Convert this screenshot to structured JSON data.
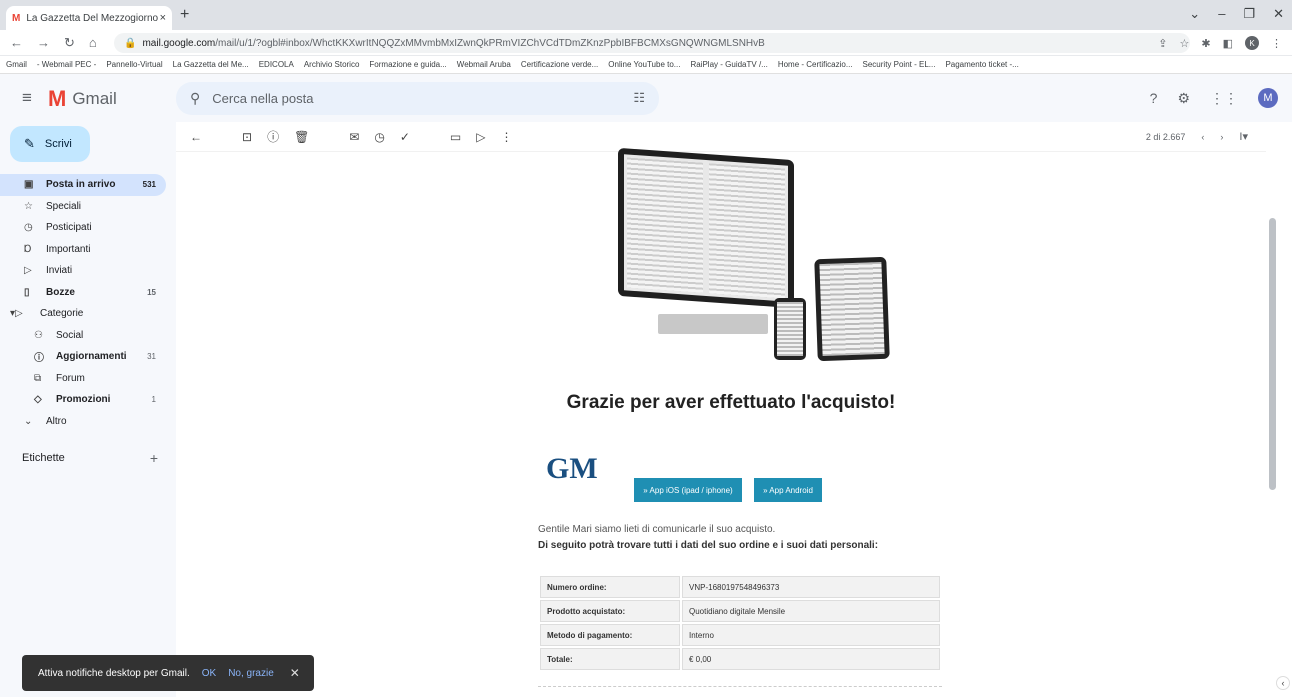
{
  "browser": {
    "tab_title": "La Gazzetta Del Mezzogiorno - A",
    "tab_close": "×",
    "new_tab": "+",
    "url_domain": "mail.google.com",
    "url_path": "/mail/u/1/?ogbl#inbox/WhctKKXwrItNQQZxMMvmbMxIZwnQkPRmVIZChVCdTDmZKnzPpbIBFBCMXsGNQWNGMLSNHvB",
    "profile": "K"
  },
  "bookmarks": [
    "Gmail",
    "- Webmail PEC -",
    "Pannello-Virtual",
    "La Gazzetta del Me...",
    "EDICOLA",
    "Archivio Storico",
    "Formazione e guida...",
    "Webmail Aruba",
    "Certificazione verde...",
    "Online YouTube to...",
    "RaiPlay - GuidaTV /...",
    "Home - Certificazio...",
    "Security Point - EL...",
    "Pagamento ticket -..."
  ],
  "gmail": {
    "brand": "Gmail",
    "search_placeholder": "Cerca nella posta",
    "avatar": "M",
    "compose": "Scrivi"
  },
  "sidebar": {
    "items": [
      {
        "label": "Posta in arrivo",
        "count": "531"
      },
      {
        "label": "Speciali",
        "count": ""
      },
      {
        "label": "Posticipati",
        "count": ""
      },
      {
        "label": "Importanti",
        "count": ""
      },
      {
        "label": "Inviati",
        "count": ""
      },
      {
        "label": "Bozze",
        "count": "15"
      },
      {
        "label": "Categorie",
        "count": ""
      },
      {
        "label": "Social",
        "count": ""
      },
      {
        "label": "Aggiornamenti",
        "count": "31"
      },
      {
        "label": "Forum",
        "count": ""
      },
      {
        "label": "Promozioni",
        "count": "1"
      },
      {
        "label": "Altro",
        "count": ""
      }
    ],
    "labels_title": "Etichette"
  },
  "toolbar": {
    "pager": "2 di 2.667"
  },
  "email": {
    "heading": "Grazie per aver effettuato l'acquisto!",
    "logo": "GM",
    "btn_ios": "» App iOS (ipad / iphone)",
    "btn_android": "» App Android",
    "intro": "Gentile Mari siamo lieti di comunicarle il suo acquisto.",
    "intro_bold": "Di seguito potrà trovare tutti i dati del suo ordine e i suoi dati personali:",
    "rows": [
      {
        "k": "Numero ordine:",
        "v": "VNP-1680197548496373"
      },
      {
        "k": "Prodotto acquistato:",
        "v": "Quotidiano digitale Mensile"
      },
      {
        "k": "Metodo di pagamento:",
        "v": "Interno"
      },
      {
        "k": "Totale:",
        "v": "€ 0,00"
      }
    ]
  },
  "toast": {
    "text": "Attiva notifiche desktop per Gmail.",
    "ok": "OK",
    "no": "No, grazie",
    "close": "✕"
  }
}
